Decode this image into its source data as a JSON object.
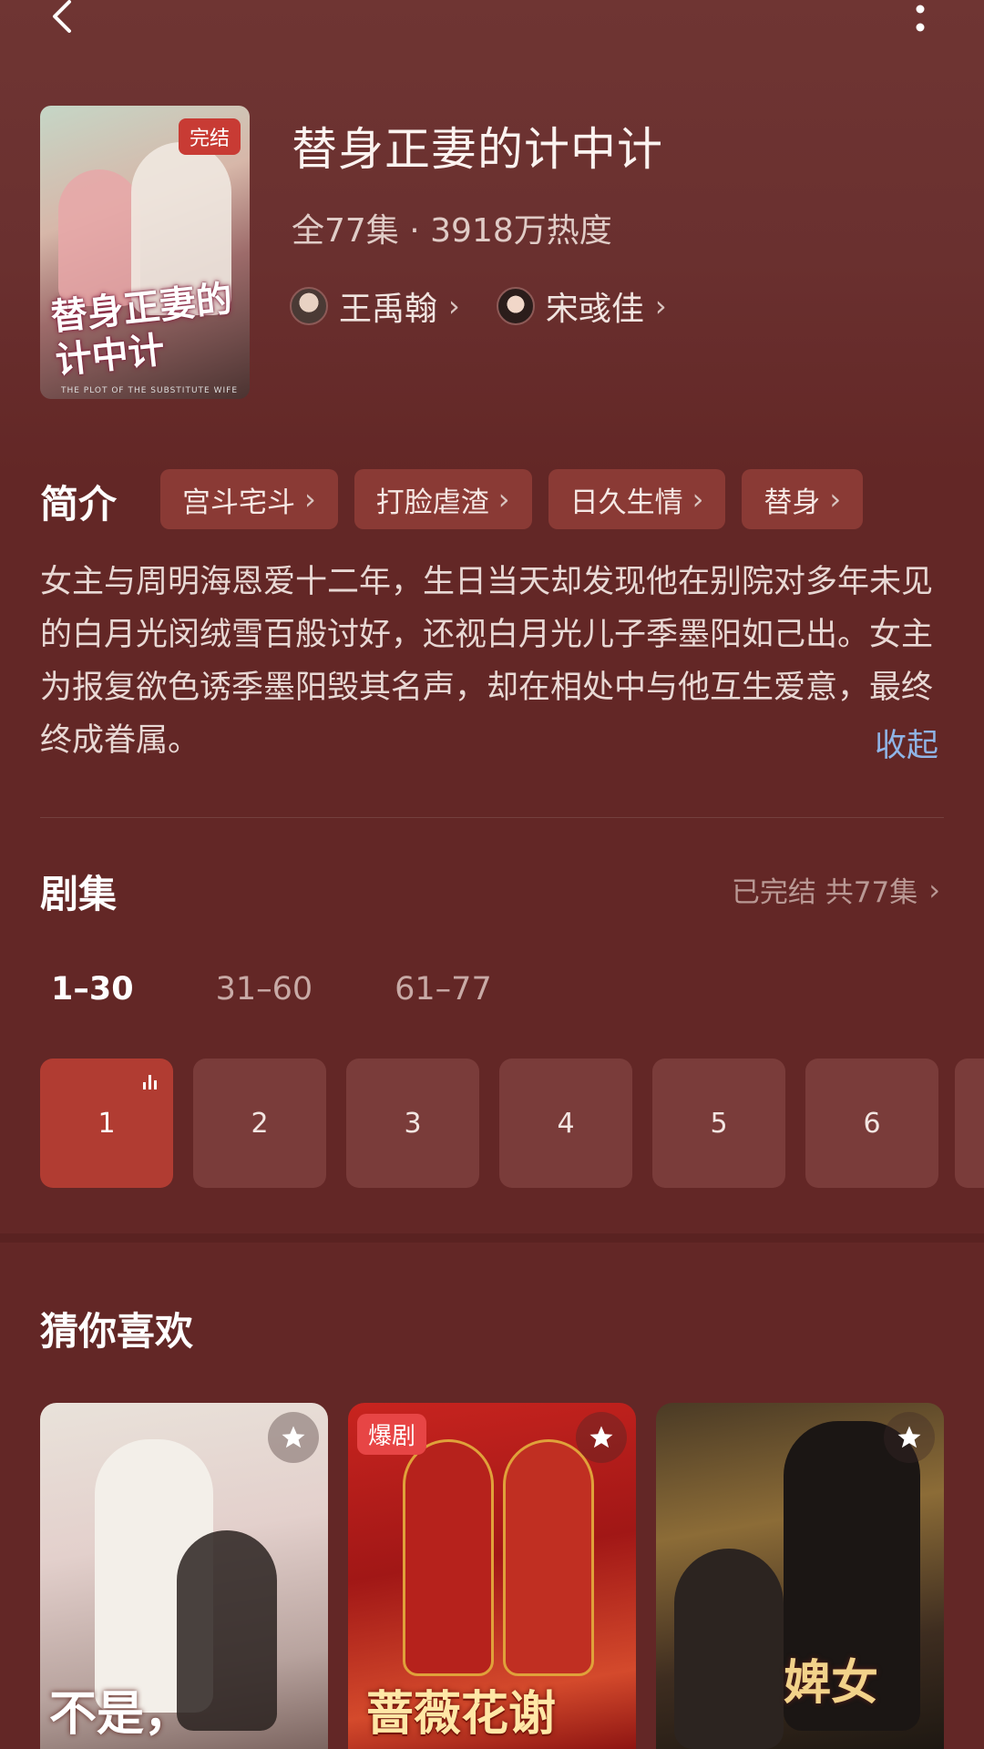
{
  "drama": {
    "title": "替身正妻的计中计",
    "meta": "全77集 · 3918万热度",
    "cover_badge": "完结",
    "cover_title": "替身正妻的计中计",
    "cover_subtitle": "THE PLOT OF THE SUBSTITUTE WIFE",
    "actors": [
      {
        "name": "王禹翰"
      },
      {
        "name": "宋彧佳"
      }
    ]
  },
  "intro": {
    "label": "简介",
    "tags": [
      "宫斗宅斗",
      "打脸虐渣",
      "日久生情",
      "替身"
    ],
    "description": "女主与周明海恩爱十二年，生日当天却发现他在别院对多年未见的白月光闵绒雪百般讨好，还视白月光儿子季墨阳如己出。女主为报复欲色诱季墨阳毁其名声，却在相处中与他互生爱意，最终终成眷属。",
    "collapse": "收起"
  },
  "episodes": {
    "title": "剧集",
    "status": "已完结 共77集",
    "ranges": [
      "1–30",
      "31–60",
      "61–77"
    ],
    "active_range": 0,
    "items": [
      "1",
      "2",
      "3",
      "4",
      "5",
      "6"
    ],
    "current": 1
  },
  "recommend": {
    "title": "猜你喜欢",
    "items": [
      {
        "caption": "不是，"
      },
      {
        "badge": "爆剧",
        "caption": "蔷薇花谢"
      },
      {
        "caption": "婢女"
      }
    ]
  },
  "colors": {
    "background": "#632726",
    "accent": "#b13c32",
    "link": "#8fb4e6"
  }
}
